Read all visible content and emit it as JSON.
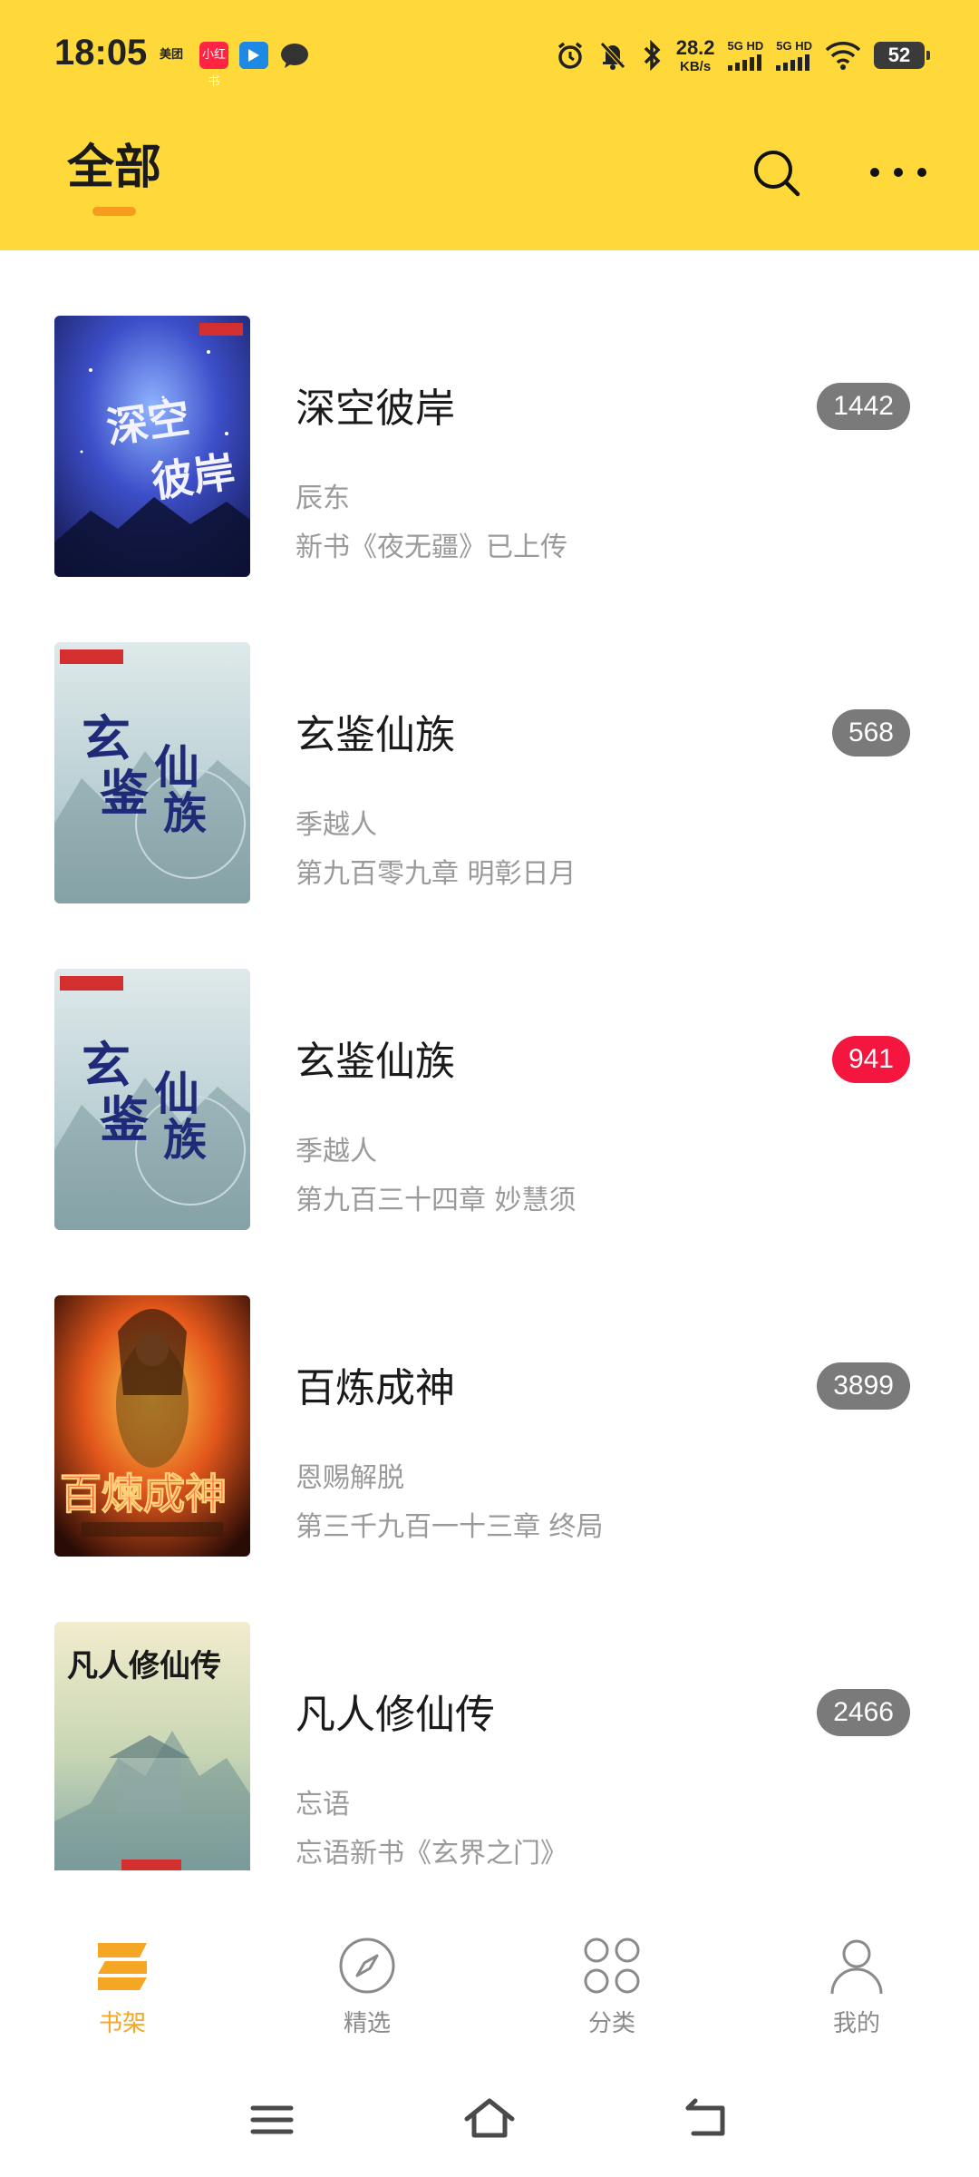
{
  "status_bar": {
    "time": "18:05",
    "app_icons": [
      "美团",
      "小红书",
      "",
      ""
    ],
    "net_speed_value": "28.2",
    "net_speed_unit": "KB/s",
    "sim1_label": "5G HD",
    "sim2_label": "5G HD",
    "battery": "52"
  },
  "header": {
    "title": "全部",
    "accent_color": "#FFD83A",
    "underline_color": "#F79B1C",
    "search_icon": "search-icon",
    "more_icon": "more-horizontal-icon"
  },
  "books": [
    {
      "title": "深空彼岸",
      "author": "辰东",
      "latest": "新书《夜无疆》已上传",
      "count": "1442",
      "badge_color": "#7a7a7a",
      "cover_text": "深空彼岸"
    },
    {
      "title": "玄鉴仙族",
      "author": "季越人",
      "latest": "第九百零九章 明彰日月",
      "count": "568",
      "badge_color": "#7a7a7a",
      "cover_text": "玄鉴仙族"
    },
    {
      "title": "玄鉴仙族",
      "author": "季越人",
      "latest": "第九百三十四章 妙慧须",
      "count": "941",
      "badge_color": "#F4163F",
      "cover_text": "玄鉴仙族"
    },
    {
      "title": "百炼成神",
      "author": "恩赐解脱",
      "latest": "第三千九百一十三章 终局",
      "count": "3899",
      "badge_color": "#7a7a7a",
      "cover_text": "百煉成神"
    },
    {
      "title": "凡人修仙传",
      "author": "忘语",
      "latest": "忘语新书《玄界之门》",
      "count": "2466",
      "badge_color": "#7a7a7a",
      "cover_text": "凡人修仙传"
    }
  ],
  "bottom_nav": {
    "items": [
      {
        "label": "书架",
        "icon": "bookshelf-icon",
        "active": true
      },
      {
        "label": "精选",
        "icon": "compass-icon",
        "active": false
      },
      {
        "label": "分类",
        "icon": "category-grid-icon",
        "active": false
      },
      {
        "label": "我的",
        "icon": "user-icon",
        "active": false
      }
    ],
    "active_color": "#F5A623"
  },
  "system_nav": {
    "items": [
      "menu-icon",
      "home-icon",
      "back-icon"
    ]
  }
}
